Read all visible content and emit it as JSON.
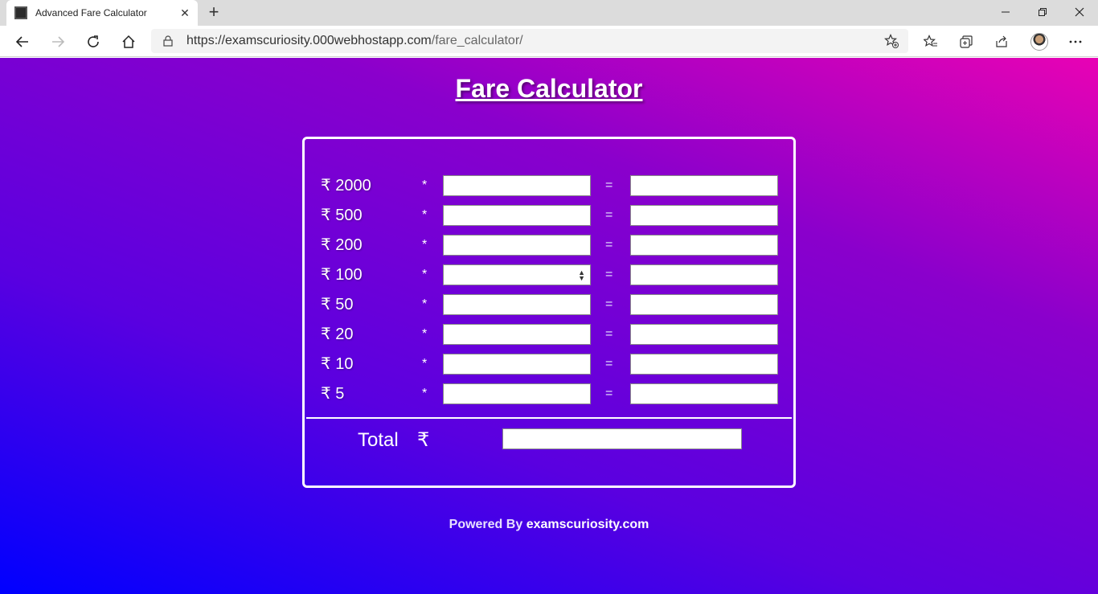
{
  "browser": {
    "tab_title": "Advanced Fare Calculator",
    "url_host": "https://examscuriosity.000webhostapp.com",
    "url_path": "/fare_calculator/"
  },
  "page": {
    "title": "Fare Calculator",
    "multiply_symbol": "*",
    "equals_symbol": "=",
    "rows": [
      {
        "denomination": "₹ 2000"
      },
      {
        "denomination": "₹ 500"
      },
      {
        "denomination": "₹ 200"
      },
      {
        "denomination": "₹ 100"
      },
      {
        "denomination": "₹ 50"
      },
      {
        "denomination": "₹ 20"
      },
      {
        "denomination": "₹ 10"
      },
      {
        "denomination": "₹ 5"
      }
    ],
    "total_label": "Total",
    "total_currency": "₹",
    "powered_prefix": "Powered By",
    "powered_site": "examscuriosity.com"
  },
  "colors": {
    "gradient_top_right": "#e802b4",
    "gradient_mid": "#8a00cc",
    "gradient_bottom_left": "#0000ff"
  }
}
